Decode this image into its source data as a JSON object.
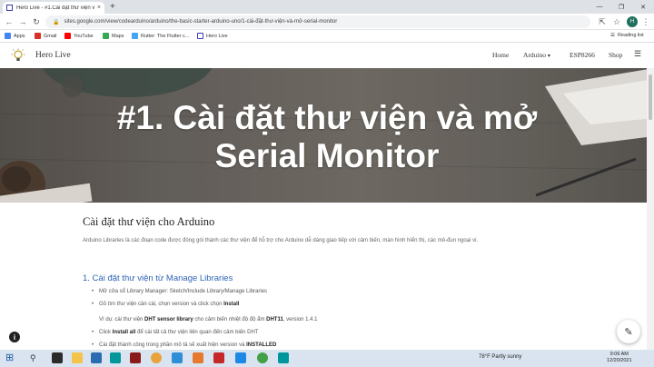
{
  "browser": {
    "tab_title": "Hero Live - #1.Cài đặt thư viện v",
    "tab_close": "×",
    "new_tab": "+",
    "url": "sites.google.com/view/codearduino/arduino/the-basic-starter-arduino-uno/1-cài-đặt-thư-viện-và-mở-serial-monitor",
    "avatar_letter": "H",
    "bookmarks": [
      {
        "label": "Apps",
        "color": "#4285f4"
      },
      {
        "label": "Gmail",
        "color": "#d93025"
      },
      {
        "label": "YouTube",
        "color": "#ff0000"
      },
      {
        "label": "Maps",
        "color": "#34a853"
      },
      {
        "label": "Rutter: The Flutter c...",
        "color": "#42a5f5"
      },
      {
        "label": "Hero Live",
        "color": "#3a3ab0"
      }
    ],
    "reading_list": "Reading list"
  },
  "site": {
    "brand": "Hero Live",
    "nav": {
      "home": "Home",
      "arduino": "Arduino",
      "esp": "ESP8266",
      "shop": "Shop"
    },
    "hero_line1": "#1. Cài đặt thư viện và mở",
    "hero_line2": "Serial Monitor",
    "heading": "Cài đặt thư viện cho Arduino",
    "intro": "Arduino Libraries là các đoạn code được đóng gói thành các thư viện để hỗ trợ cho Arduino dễ dàng giao tiếp với cảm biến, màn hình hiển thị, các mô-đun ngoại vi.",
    "sub_heading": "1. Cài đặt thư viện từ Manage Libraries",
    "items": {
      "i1": "Mở cửa sổ Library Manager: Sketch/Include Library/Manage Libraries",
      "i2a": "Gõ tìm thư viện cần cài, chọn version và click chọn ",
      "i2b": "Install",
      "ex_a": "Ví dụ: cài thư viện ",
      "ex_b": "DHT sensor library",
      "ex_c": " cho cảm biến nhiệt độ độ ẩm ",
      "ex_d": "DHT11",
      "ex_e": ", version 1.4.1",
      "i3a": "Click ",
      "i3b": "Install all",
      "i3c": " để cài tất cả thư viện liên quan đến cảm biến DHT",
      "i4a": "Cài đặt thành công trong phần mô tả sẽ xuất hiện version và ",
      "i4b": "INSTALLED"
    }
  },
  "taskbar": {
    "weather": "78°F  Partly sunny",
    "time": "9:06 AM",
    "date": "12/20/2021"
  }
}
